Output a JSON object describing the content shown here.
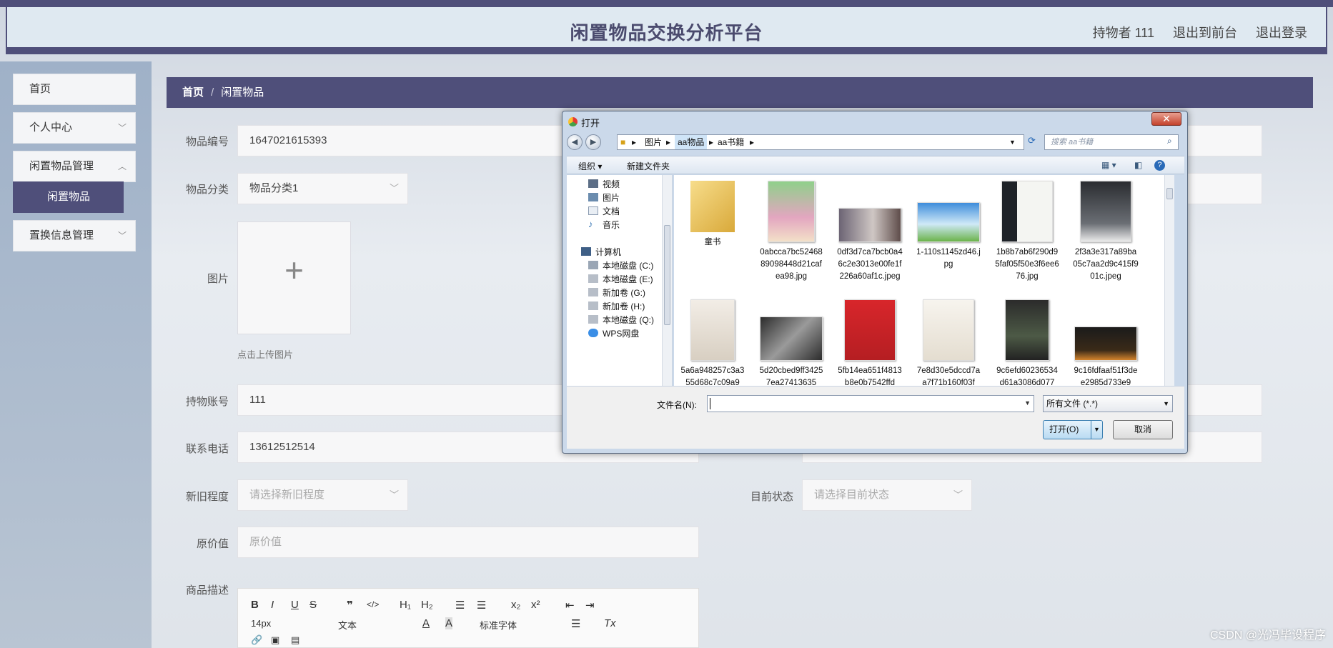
{
  "header": {
    "title": "闲置物品交换分析平台",
    "user_label": "持物者 111",
    "back_front_label": "退出到前台",
    "logout_label": "退出登录"
  },
  "sidebar": {
    "items": [
      {
        "label": "首页"
      },
      {
        "label": "个人中心"
      },
      {
        "label": "闲置物品管理"
      },
      {
        "label": "闲置物品"
      },
      {
        "label": "置换信息管理"
      }
    ]
  },
  "breadcrumb": {
    "home": "首页",
    "sep": "/",
    "current": "闲置物品"
  },
  "form": {
    "item_no_label": "物品编号",
    "item_no_value": "1647021615393",
    "category_label": "物品分类",
    "category_value": "物品分类1",
    "image_label": "图片",
    "upload_plus": "+",
    "upload_hint": "点击上传图片",
    "account_label": "持物账号",
    "account_value": "111",
    "phone_label": "联系电话",
    "phone_value": "13612512514",
    "condition_label": "新旧程度",
    "condition_placeholder": "请选择新旧程度",
    "status_label": "目前状态",
    "status_placeholder": "请选择目前状态",
    "price_label": "原价值",
    "price_placeholder": "原价值",
    "desc_label": "商品描述"
  },
  "editor": {
    "bold": "B",
    "italic": "I",
    "underline": "U",
    "strike": "S",
    "quote": "❞",
    "code": "</>",
    "h1": "H₁",
    "h2": "H₂",
    "ol": "☰",
    "ul": "☰",
    "sub": "x₂",
    "sup": "x²",
    "outdent": "⇤",
    "indent": "⇥",
    "size": "14px",
    "text": "文本",
    "font": "标准字体",
    "color": "A",
    "bg": "A",
    "align": "☰",
    "clear": "Tx"
  },
  "dialog": {
    "title": "打开",
    "close": "✕",
    "path": [
      "图片",
      "aa物品",
      "aa书籍"
    ],
    "search_placeholder": "搜索 aa书籍",
    "organize": "组织 ▾",
    "new_folder": "新建文件夹",
    "nav": [
      {
        "label": "视频"
      },
      {
        "label": "图片"
      },
      {
        "label": "文档"
      },
      {
        "label": "音乐"
      },
      {
        "label": "计算机"
      },
      {
        "label": "本地磁盘 (C:)"
      },
      {
        "label": "本地磁盘 (E:)"
      },
      {
        "label": "新加卷 (G:)"
      },
      {
        "label": "新加卷 (H:)"
      },
      {
        "label": "本地磁盘 (Q:)"
      },
      {
        "label": "WPS网盘"
      }
    ],
    "files": [
      {
        "name": "童书"
      },
      {
        "name": "0abcca7bc5246889098448d21cafea98.jpg"
      },
      {
        "name": "0df3d7ca7bcb0a46c2e3013e00fe1f226a60af1c.jpeg"
      },
      {
        "name": "1-110s1145zd46.jpg"
      },
      {
        "name": "1b8b7ab6f290d95faf05f50e3f6ee676.jpg"
      },
      {
        "name": "2f3a3e317a89ba05c7aa2d9c415f901c.jpeg"
      },
      {
        "name": "5a6a948257c3a355d68c7c09a9"
      },
      {
        "name": "5d20cbed9ff34257ea27413635"
      },
      {
        "name": "5fb14ea651f4813b8e0b7542ffd"
      },
      {
        "name": "7e8d30e5dccd7aa7f71b160f03f"
      },
      {
        "name": "9c6efd60236534d61a3086d077"
      },
      {
        "name": "9c16fdfaaf51f3dee2985d733e9"
      }
    ],
    "filename_label": "文件名(N):",
    "filetype": "所有文件 (*.*)",
    "open_label": "打开(O)",
    "cancel_label": "取消"
  },
  "watermark": "CSDN @光冯毕设程序",
  "colors": {
    "primary": "#4f4f7a",
    "header_bg": "#dfe9f1"
  }
}
